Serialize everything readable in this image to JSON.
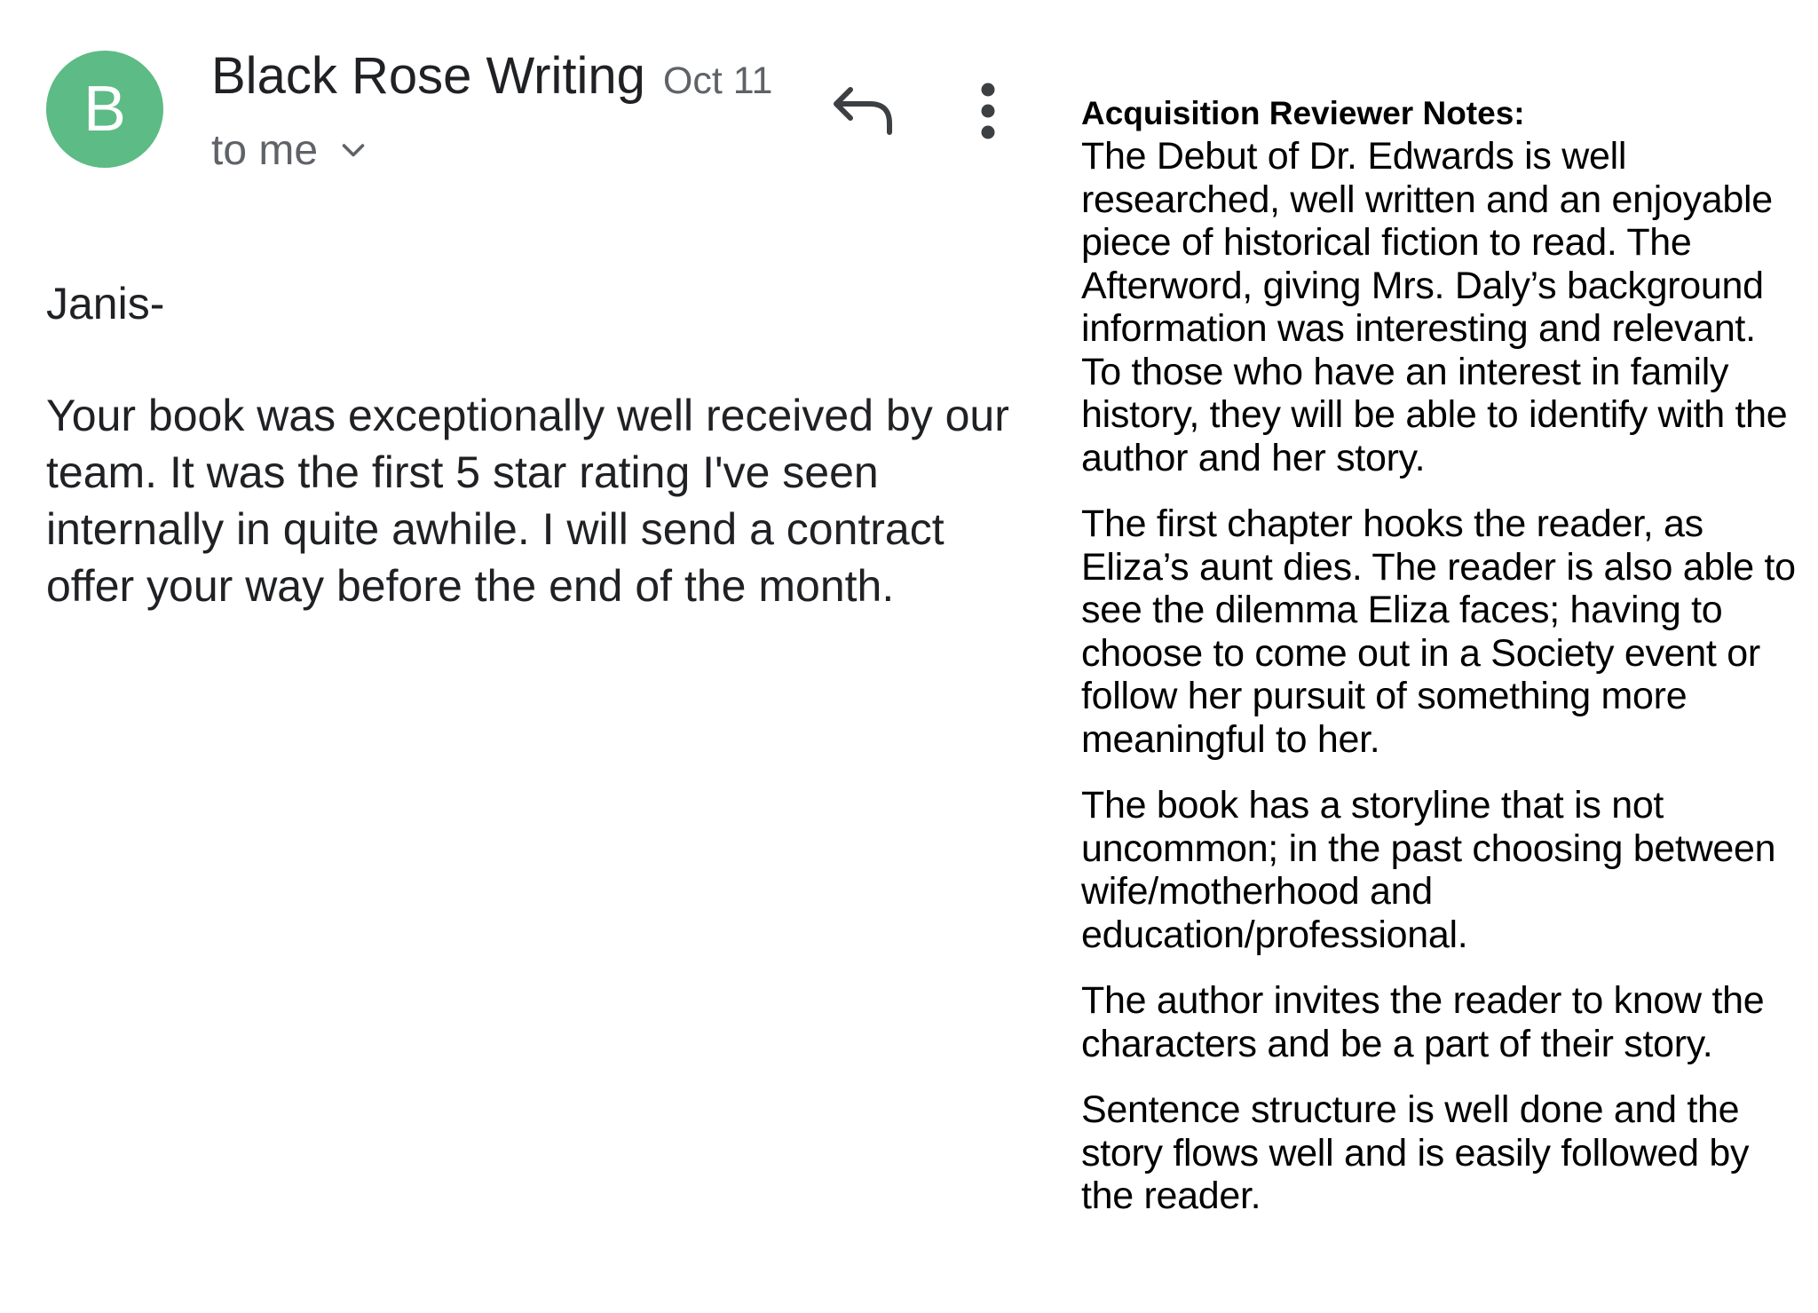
{
  "email": {
    "avatar_letter": "B",
    "avatar_color": "#5dbb85",
    "sender": "Black Rose Writing",
    "date": "Oct 11",
    "recipient": "to me",
    "greeting": "Janis-",
    "body": "Your book was exceptionally well received by our team. It was the first 5 star rating I've seen internally in quite awhile. I will send a contract offer your way before the end of the month."
  },
  "actions": {
    "reply_icon": "reply-icon",
    "more_icon": "more-vert-icon",
    "expand_icon": "chevron-down-icon"
  },
  "notes": {
    "heading": "Acquisition Reviewer Notes:",
    "paragraphs": [
      "The Debut of Dr. Edwards is well researched, well written and an enjoyable piece of historical fiction to read. The Afterword, giving Mrs. Daly’s background information was interesting and relevant. To those who have an interest in family history, they will be able to identify with the author and her story.",
      "The first chapter hooks the reader, as Eliza’s aunt dies. The reader is also able to see the dilemma Eliza faces; having to choose to come out in a Society event or follow her pursuit of something more meaningful to her.",
      "The book has a storyline that is not uncommon; in the past choosing between wife/motherhood and education/professional.",
      "The author invites the reader to know the characters and be a part of their story.",
      "Sentence structure is well done and the story flows well and is easily followed by the reader."
    ]
  }
}
